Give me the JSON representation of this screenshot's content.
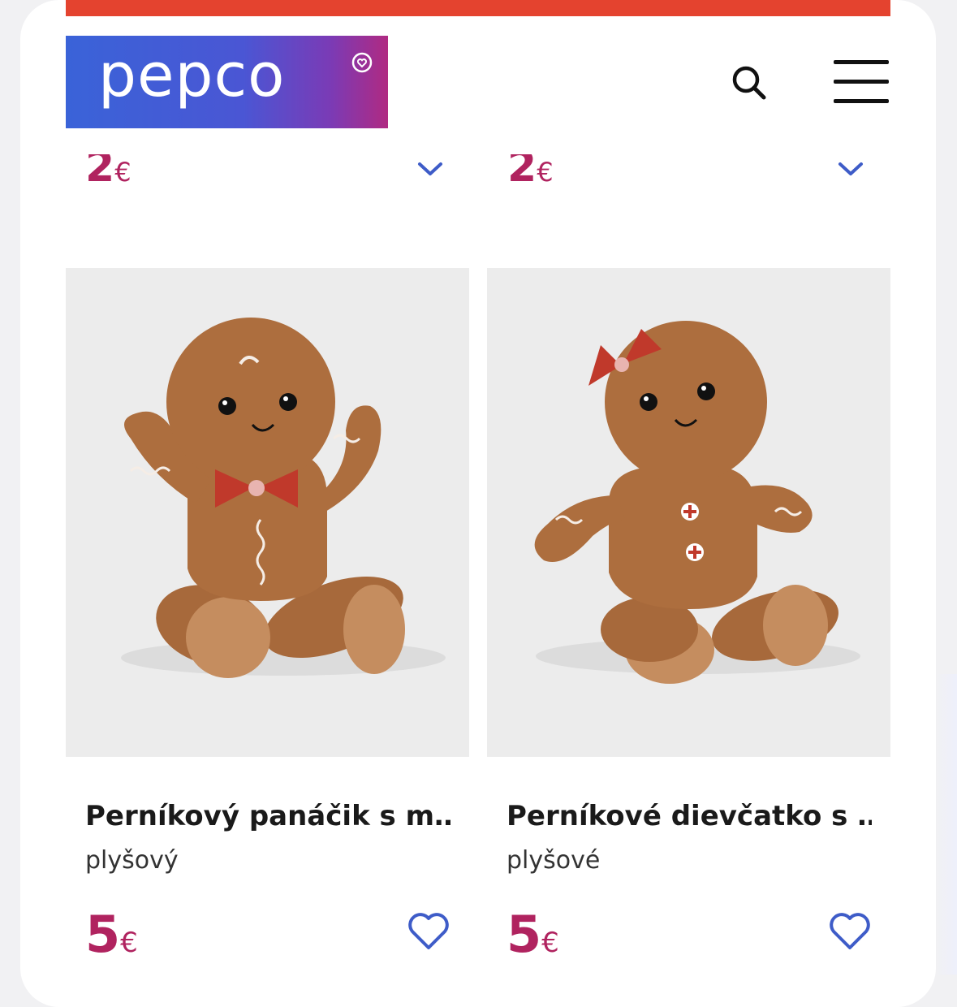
{
  "header": {
    "logo_text": "pepco",
    "brand_colors": [
      "#3a63d8",
      "#7a3bb6",
      "#b02a82"
    ],
    "promo_bar_color": "#e4432f",
    "search_icon": "search-icon",
    "menu_icon": "hamburger-menu-icon"
  },
  "previous_row": [
    {
      "price": "2",
      "currency": "€"
    },
    {
      "price": "2",
      "currency": "€"
    }
  ],
  "products": [
    {
      "title": "Perníkový panáčik s m…",
      "subtitle": "plyšový",
      "price": "5",
      "currency": "€",
      "image": "gingerbread-boy-plush",
      "wishlist_icon": "heart-icon"
    },
    {
      "title": "Perníkové dievčatko s …",
      "subtitle": "plyšové",
      "price": "5",
      "currency": "€",
      "image": "gingerbread-girl-plush",
      "wishlist_icon": "heart-icon"
    }
  ],
  "colors": {
    "price": "#b0235f",
    "icon_blue": "#3e5cc8"
  }
}
